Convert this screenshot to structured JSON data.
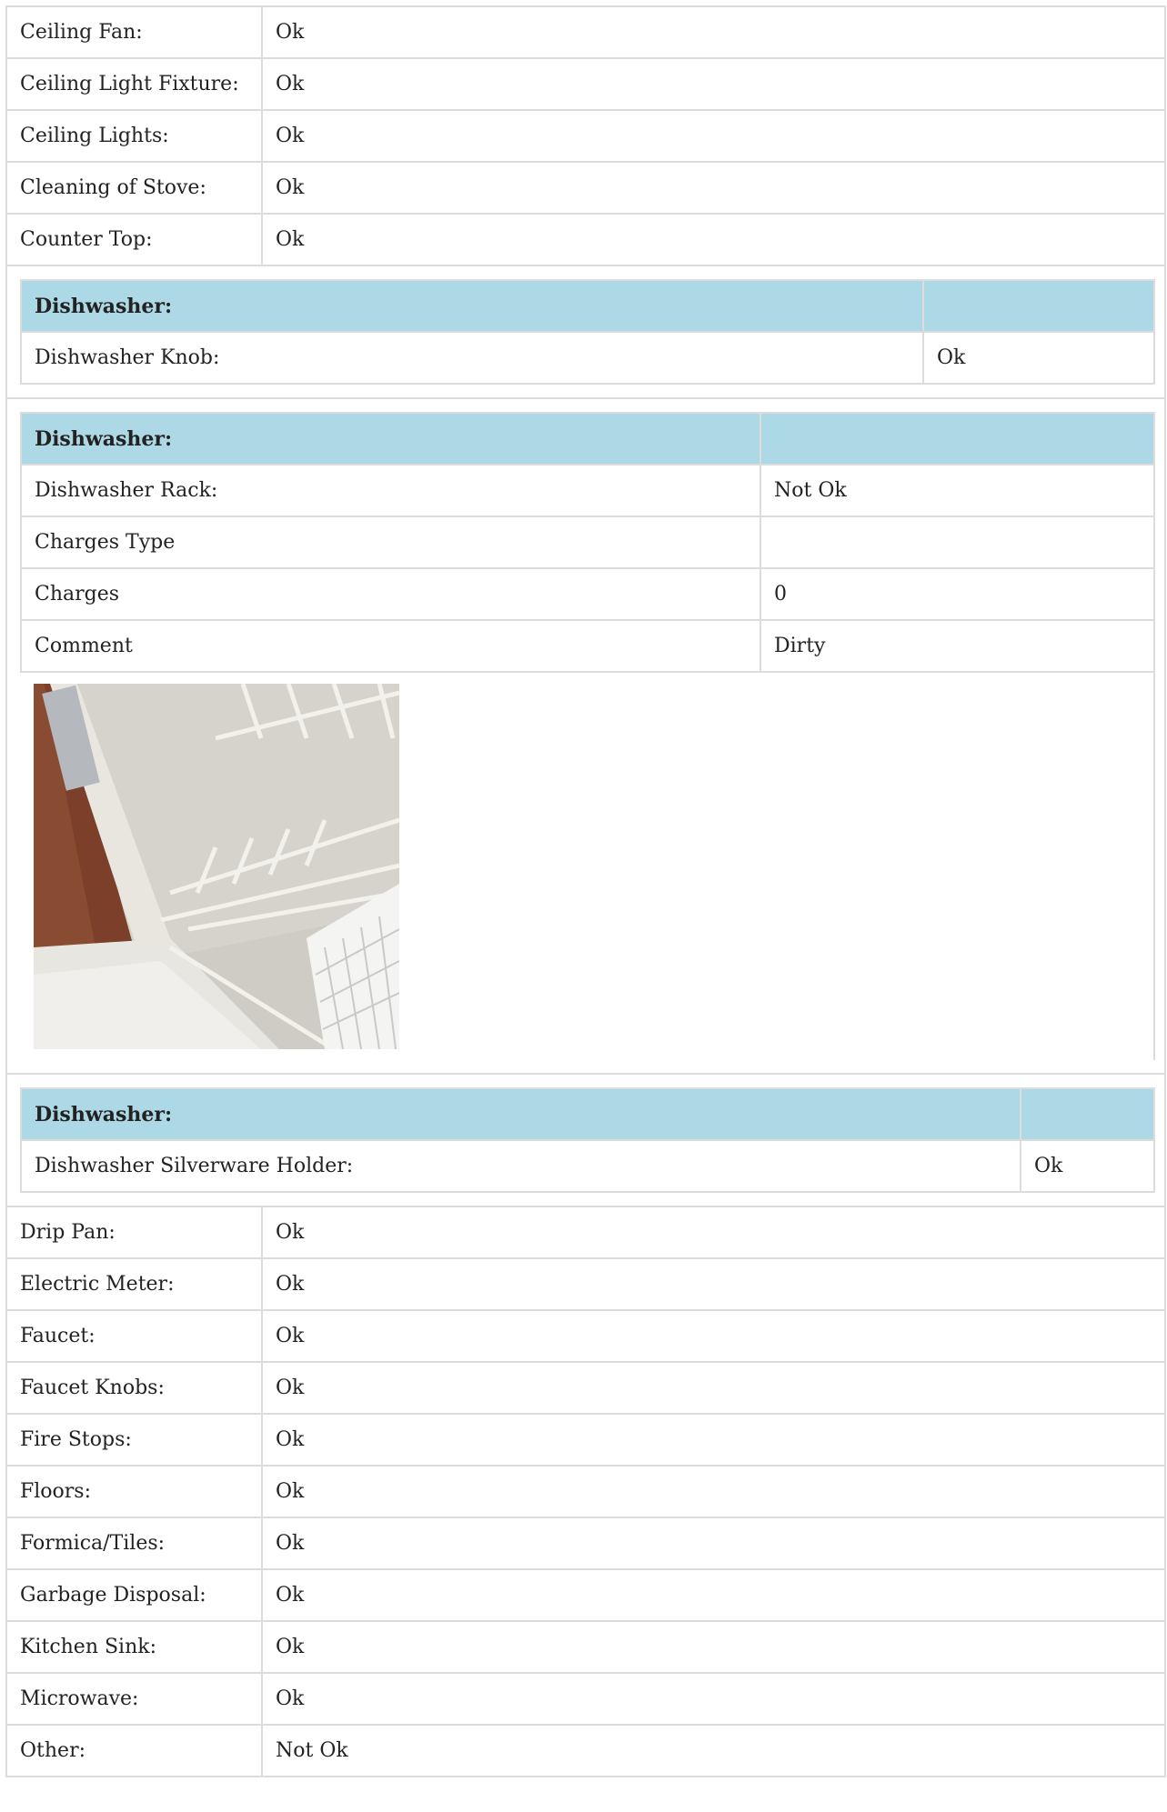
{
  "rows_top": [
    {
      "label": "Ceiling Fan:",
      "value": "Ok"
    },
    {
      "label": "Ceiling Light Fixture:",
      "value": "Ok"
    },
    {
      "label": "Ceiling Lights:",
      "value": "Ok"
    },
    {
      "label": "Cleaning of Stove:",
      "value": "Ok"
    },
    {
      "label": "Counter Top:",
      "value": "Ok"
    }
  ],
  "dishwasher_knob": {
    "header": "Dishwasher:",
    "label": "Dishwasher Knob:",
    "value": "Ok"
  },
  "dishwasher_rack": {
    "header": "Dishwasher:",
    "label": "Dishwasher Rack:",
    "value": "Not Ok",
    "charges_type_label": "Charges Type",
    "charges_type_value": "",
    "charges_label": "Charges",
    "charges_value": "0",
    "comment_label": "Comment",
    "comment_value": "Dirty"
  },
  "dishwasher_silverware": {
    "header": "Dishwasher:",
    "label": "Dishwasher Silverware Holder:",
    "value": "Ok"
  },
  "rows_bottom": [
    {
      "label": "Drip Pan:",
      "value": "Ok"
    },
    {
      "label": "Electric Meter:",
      "value": "Ok"
    },
    {
      "label": "Faucet:",
      "value": "Ok"
    },
    {
      "label": "Faucet Knobs:",
      "value": "Ok"
    },
    {
      "label": "Fire Stops:",
      "value": "Ok"
    },
    {
      "label": "Floors:",
      "value": "Ok"
    },
    {
      "label": "Formica/Tiles:",
      "value": "Ok"
    },
    {
      "label": "Garbage Disposal:",
      "value": "Ok"
    },
    {
      "label": "Kitchen Sink:",
      "value": "Ok"
    },
    {
      "label": "Microwave:",
      "value": "Ok"
    },
    {
      "label": "Other:",
      "value": "Not Ok"
    }
  ],
  "colors": {
    "section_header": "#add8e6",
    "border": "#dcdcdc"
  }
}
